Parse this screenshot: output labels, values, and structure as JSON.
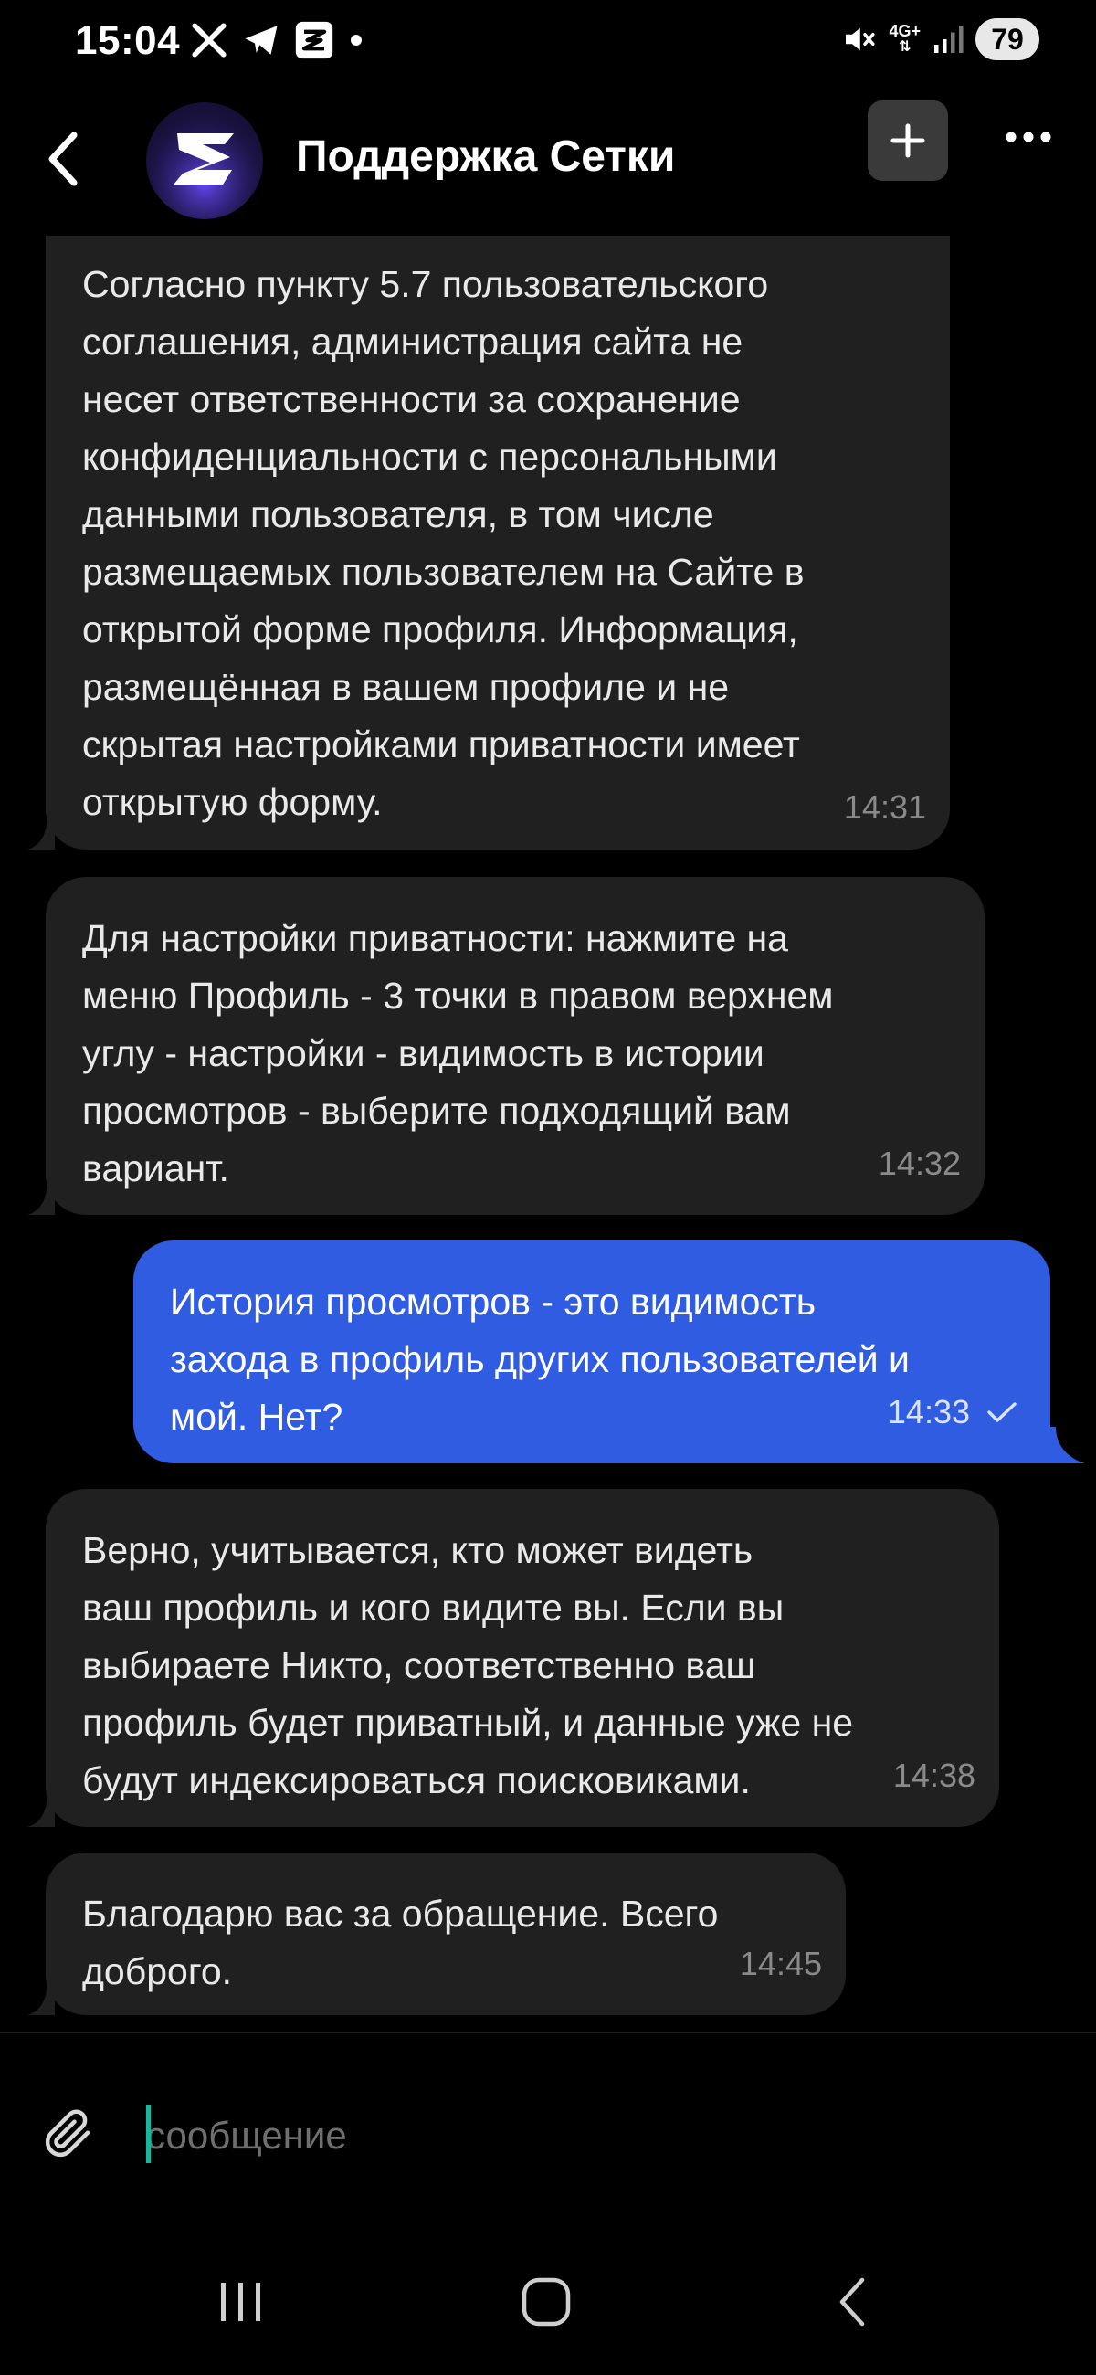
{
  "status_bar": {
    "time": "15:04",
    "network": "4G+",
    "battery": "79",
    "left_icons": [
      "x-icon",
      "telegram-icon",
      "setka-icon",
      "dot-icon"
    ],
    "right_icons": [
      "mute-icon",
      "signal-icon",
      "battery-icon"
    ]
  },
  "header": {
    "title": "Поддержка Сетки",
    "back_icon": "chevron-left-icon",
    "add_icon": "plus-icon",
    "more_icon": "more-dots-icon",
    "add_button_color": "#3a3a3a"
  },
  "messages": [
    {
      "direction": "incoming",
      "text": "Согласно пункту 5.7 пользовательского\nсоглашения, администрация сайта не\nнесет ответственности за сохранение\nконфиденциальности с персональными\nданными пользователя, в том числе\nразмещаемых пользователем на Сайте в\nоткрытой форме профиля. Информация,\nразмещённая в вашем профиле и не\nскрытая настройками приватности имеет\nоткрытую форму.",
      "time": "14:31"
    },
    {
      "direction": "incoming",
      "text": "Для настройки приватности: нажмите на\nменю Профиль - 3 точки в правом верхнем\nуглу - настройки - видимость в истории\nпросмотров - выберите подходящий вам\nвариант.",
      "time": "14:32"
    },
    {
      "direction": "outgoing",
      "text": "История просмотров - это видимость\nзахода в профиль других пользователей и\nмой. Нет?",
      "time": "14:33",
      "status": "sent"
    },
    {
      "direction": "incoming",
      "text": "Верно, учитывается, кто может видеть\nваш профиль и кого видите вы. Если вы\nвыбираете Никто, соответственно ваш\nпрофиль будет приватный, и данные уже не\nбудут индексироваться поисковиками.",
      "time": "14:38"
    },
    {
      "direction": "incoming",
      "text": "Благодарю вас за обращение. Всего\nдоброго.",
      "time": "14:45"
    }
  ],
  "composer": {
    "placeholder": "сообщение",
    "value": "",
    "attach_icon": "paperclip-icon"
  },
  "nav_bar": {
    "icons": [
      "recents-icon",
      "home-icon",
      "back-icon"
    ]
  },
  "colors": {
    "background": "#000000",
    "incoming_bubble": "#202020",
    "outgoing_bubble": "#2f5ce0",
    "caret": "#19b6a0"
  }
}
